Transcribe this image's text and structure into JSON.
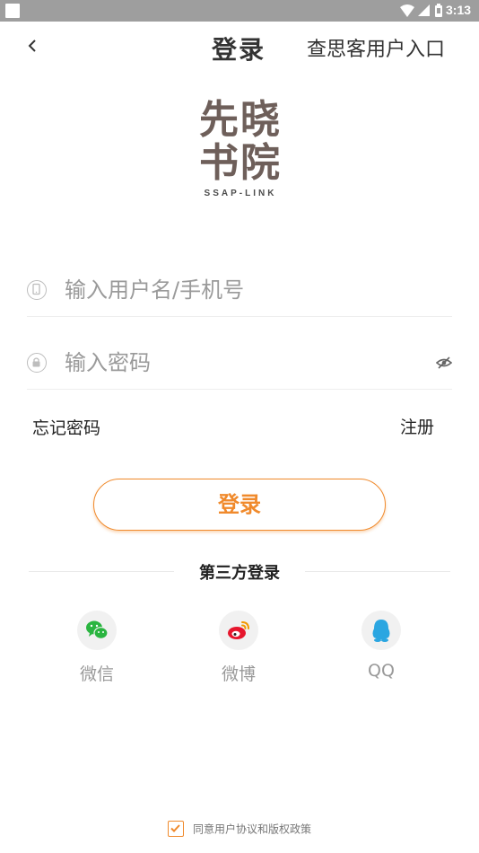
{
  "status_bar": {
    "time": "3:13"
  },
  "header": {
    "title": "登录",
    "right_link": "查思客用户入口"
  },
  "logo": {
    "line1": "先晓",
    "line2": "书院",
    "subtitle": "SSAP-LINK"
  },
  "form": {
    "username_placeholder": "输入用户名/手机号",
    "password_placeholder": "输入密码",
    "forgot_label": "忘记密码",
    "register_label": "注册",
    "login_button": "登录"
  },
  "third_party": {
    "label": "第三方登录",
    "items": [
      {
        "name": "微信",
        "icon": "wechat-icon",
        "color": "#2ab540"
      },
      {
        "name": "微博",
        "icon": "weibo-icon",
        "color": "#e6162d"
      },
      {
        "name": "QQ",
        "icon": "qq-icon",
        "color": "#2ba6e1"
      }
    ]
  },
  "agreement": {
    "text": "同意用户协议和版权政策",
    "checked": true
  },
  "colors": {
    "accent": "#f08a2c",
    "status_bar": "#9e9e9e"
  }
}
